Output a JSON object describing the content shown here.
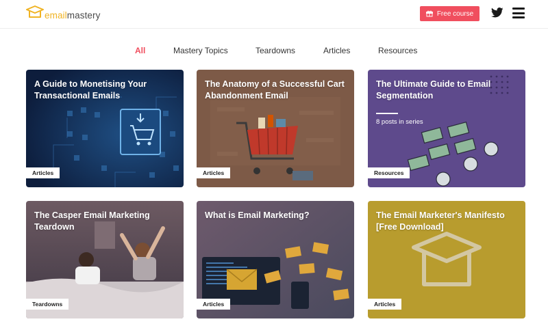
{
  "brand": {
    "email": "email",
    "mastery": "mastery"
  },
  "header": {
    "free_course_label": "Free course"
  },
  "icons": {
    "logo": "graduation-cap-icon",
    "gift": "gift-icon",
    "twitter": "twitter-icon",
    "menu": "hamburger-menu-icon"
  },
  "colors": {
    "accent": "#f04e5e",
    "brand_yellow": "#f0b323"
  },
  "nav": {
    "items": [
      {
        "label": "All",
        "active": true
      },
      {
        "label": "Mastery Topics"
      },
      {
        "label": "Teardowns"
      },
      {
        "label": "Articles"
      },
      {
        "label": "Resources"
      }
    ]
  },
  "cards": [
    {
      "title": "A Guide to Monetising Your Transactional Emails",
      "tag": "Articles"
    },
    {
      "title": "The Anatomy of a Successful Cart Abandonment Email",
      "tag": "Articles"
    },
    {
      "title": "The Ultimate Guide to Email Segmentation",
      "series": "8 posts in series",
      "tag": "Resources"
    },
    {
      "title": "The Casper Email Marketing Teardown",
      "tag": "Teardowns"
    },
    {
      "title": "What is Email Marketing?",
      "tag": "Articles"
    },
    {
      "title": "The Email Marketer's Manifesto [Free Download]",
      "tag": "Articles"
    }
  ]
}
